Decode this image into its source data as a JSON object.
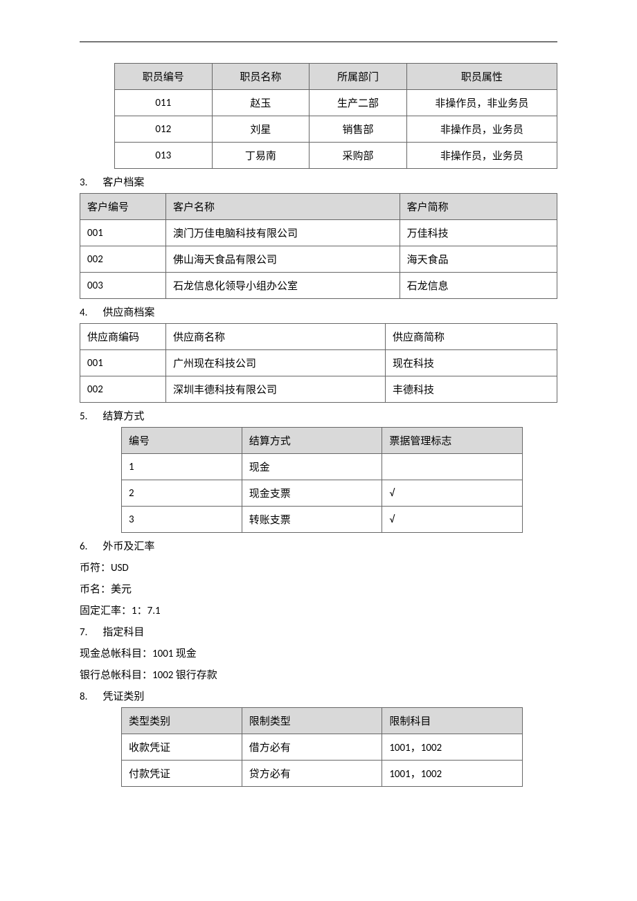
{
  "tables": {
    "employee": {
      "headers": [
        "职员编号",
        "职员名称",
        "所属部门",
        "职员属性"
      ],
      "rows": [
        [
          "011",
          "赵玉",
          "生产二部",
          "非操作员，非业务员"
        ],
        [
          "012",
          "刘星",
          "销售部",
          "非操作员，业务员"
        ],
        [
          "013",
          "丁易南",
          "采购部",
          "非操作员，业务员"
        ]
      ]
    },
    "customer": {
      "headers": [
        "客户编号",
        "客户名称",
        "客户简称"
      ],
      "rows": [
        [
          "001",
          "澳门万佳电脑科技有限公司",
          "万佳科技"
        ],
        [
          "002",
          "佛山海天食品有限公司",
          "海天食品"
        ],
        [
          "003",
          "石龙信息化领导小组办公室",
          "石龙信息"
        ]
      ]
    },
    "supplier": {
      "headers": [
        "供应商编码",
        "供应商名称",
        "供应商简称"
      ],
      "rows": [
        [
          "001",
          "广州现在科技公司",
          "现在科技"
        ],
        [
          "002",
          "深圳丰德科技有限公司",
          "丰德科技"
        ]
      ]
    },
    "settlement": {
      "headers": [
        "编号",
        "结算方式",
        "票据管理标志"
      ],
      "rows": [
        [
          "1",
          "现金",
          ""
        ],
        [
          "2",
          "现金支票",
          "√"
        ],
        [
          "3",
          "转账支票",
          "√"
        ]
      ]
    },
    "voucher": {
      "headers": [
        "类型类别",
        "限制类型",
        "限制科目"
      ],
      "rows": [
        [
          "收款凭证",
          "借方必有",
          "1001，1002"
        ],
        [
          "付款凭证",
          "贷方必有",
          "1001，1002"
        ]
      ]
    }
  },
  "sections": {
    "s3": {
      "num": "3.",
      "title": "客户档案"
    },
    "s4": {
      "num": "4.",
      "title": "供应商档案"
    },
    "s5": {
      "num": "5.",
      "title": "结算方式"
    },
    "s6": {
      "num": "6.",
      "title": "外币及汇率"
    },
    "s7": {
      "num": "7.",
      "title": "指定科目"
    },
    "s8": {
      "num": "8.",
      "title": "凭证类别"
    }
  },
  "text": {
    "currency_symbol": "币符：USD",
    "currency_name": "币名：美元",
    "fixed_rate": "固定汇率：1：7.1",
    "cash_account": "现金总帐科目：1001 现金",
    "bank_account": "银行总帐科目：1002 银行存款"
  }
}
